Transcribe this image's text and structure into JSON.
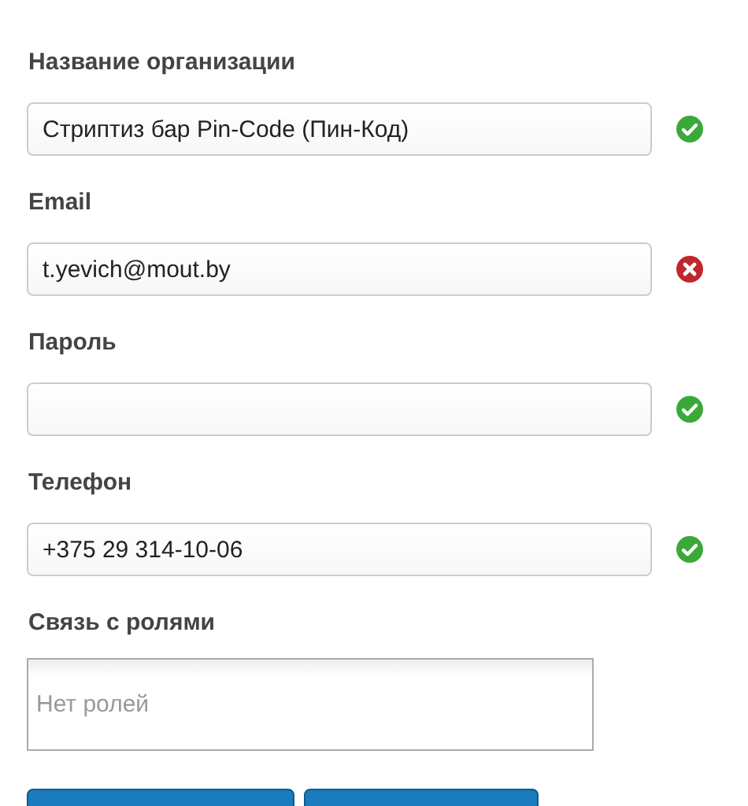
{
  "fields": [
    {
      "label": "Название организации",
      "value": "Стриптиз бар Pin-Code (Пин-Код)",
      "valid": true
    },
    {
      "label": "Email",
      "value": "t.yevich@mout.by",
      "valid": false
    },
    {
      "label": "Пароль",
      "valid": true
    },
    {
      "label": "Телефон",
      "value": "+375 29 314-10-06",
      "valid": true
    }
  ],
  "roles": {
    "label": "Связь с ролями",
    "placeholder": "Нет ролей"
  },
  "buttons": [
    {
      "kind": "primary"
    },
    {
      "kind": "primary"
    }
  ]
}
